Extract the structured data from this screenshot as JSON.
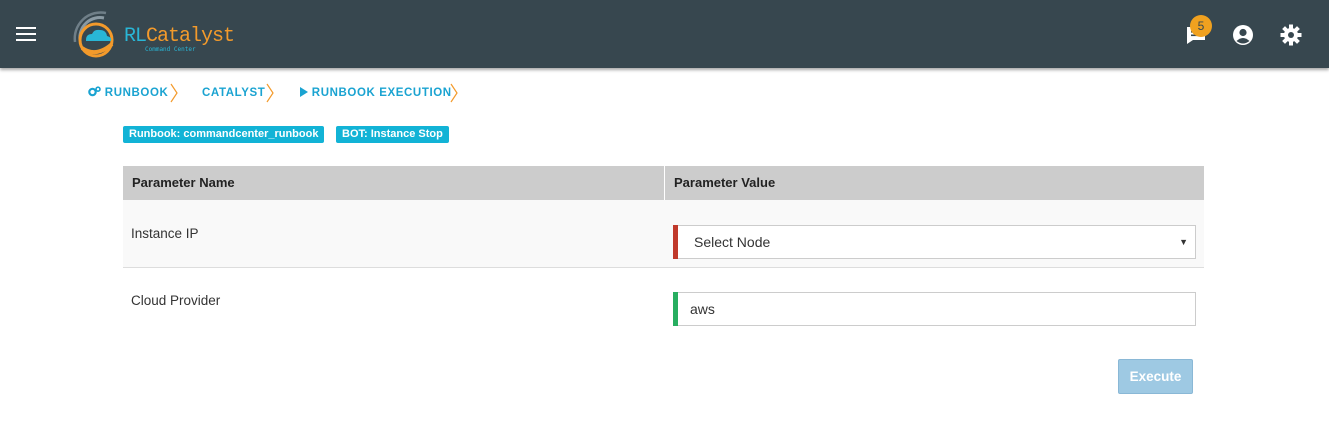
{
  "header": {
    "logo": {
      "brand_rl": "RL",
      "brand_name": "Catalyst",
      "subtitle": "Command Center"
    },
    "notification_count": "5"
  },
  "breadcrumb": [
    {
      "label": "RUNBOOK",
      "icon": "cogs-icon"
    },
    {
      "label": "CATALYST"
    },
    {
      "label": "RUNBOOK EXECUTION",
      "icon": "play-icon"
    }
  ],
  "tags": {
    "runbook": "Runbook: commandcenter_runbook",
    "bot": "BOT: Instance Stop"
  },
  "table": {
    "headers": [
      "Parameter Name",
      "Parameter Value"
    ],
    "rows": [
      {
        "name": "Instance IP",
        "value": "Select Node",
        "type": "select",
        "indicator": "#c0392b"
      },
      {
        "name": "Cloud Provider",
        "value": "aws",
        "type": "text",
        "indicator": "#27ae60"
      }
    ]
  },
  "actions": {
    "execute_label": "Execute"
  },
  "colors": {
    "topbar": "#37474f",
    "accent": "#1aa3d1",
    "tag": "#12b3d6",
    "badge": "#f0a11f",
    "chevron": "#f39a2b"
  }
}
